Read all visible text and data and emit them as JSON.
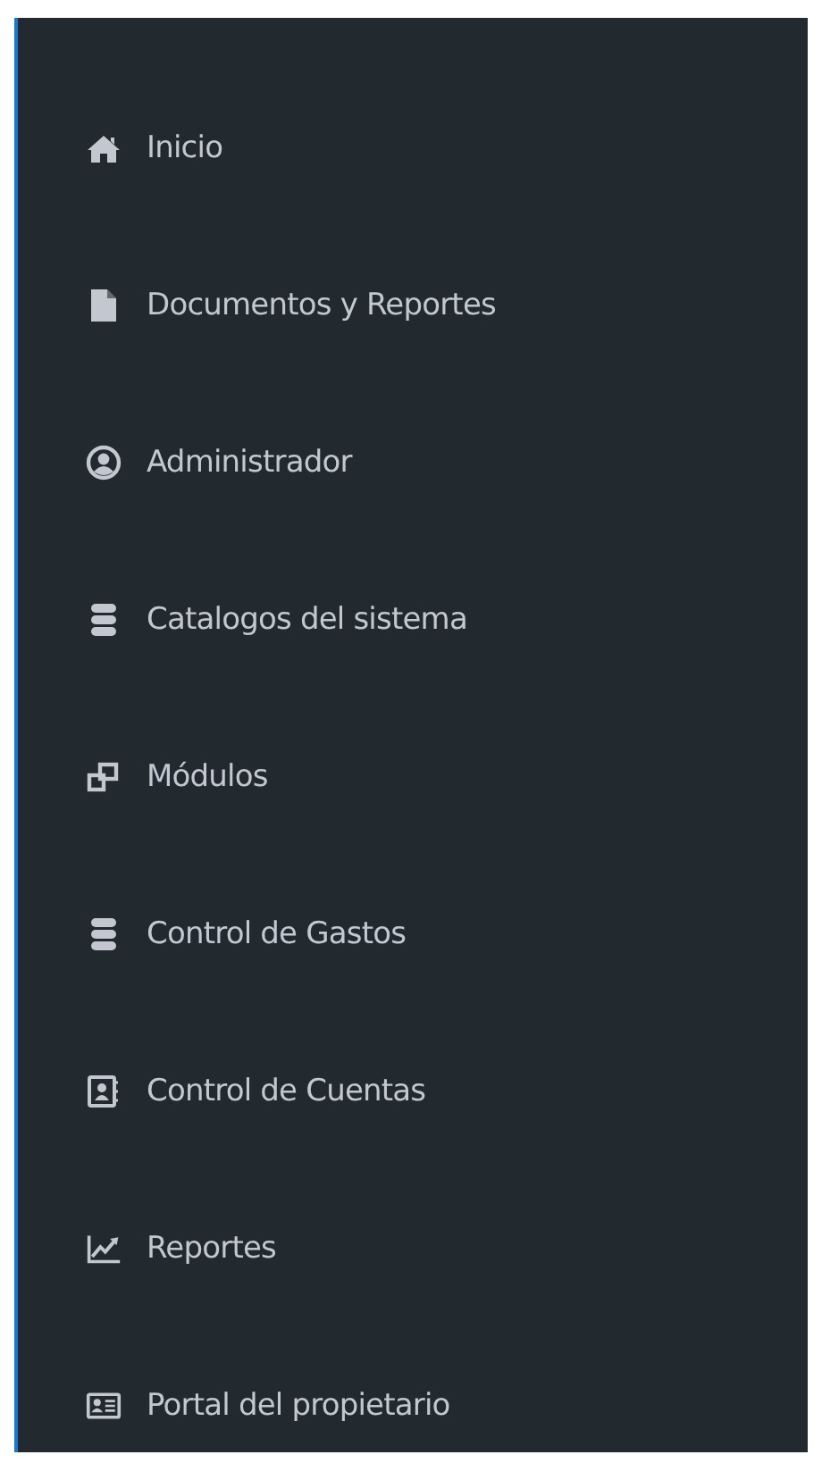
{
  "sidebar": {
    "items": [
      {
        "kind": "home",
        "label": "Inicio"
      },
      {
        "kind": "file",
        "label": "Documentos y Reportes"
      },
      {
        "kind": "user-circle",
        "label": "Administrador"
      },
      {
        "kind": "database",
        "label": "Catalogos del sistema"
      },
      {
        "kind": "windows",
        "label": "Módulos"
      },
      {
        "kind": "database",
        "label": "Control de Gastos"
      },
      {
        "kind": "contact-book",
        "label": "Control de Cuentas"
      },
      {
        "kind": "chart",
        "label": "Reportes"
      },
      {
        "kind": "id-card",
        "label": "Portal del propietario"
      }
    ]
  }
}
